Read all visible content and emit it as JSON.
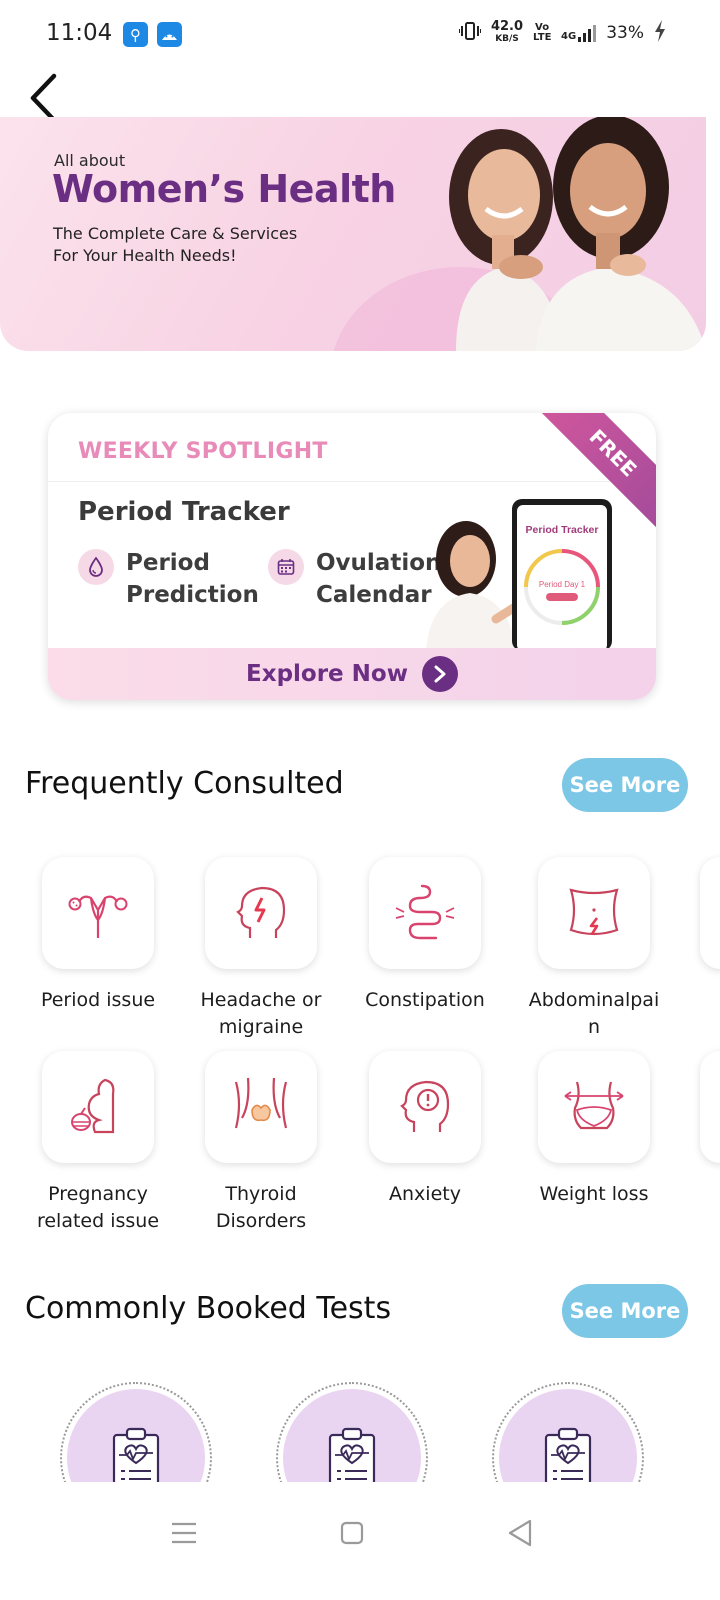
{
  "status_bar": {
    "time": "11:04",
    "speed_value": "42.0",
    "speed_unit": "KB/S",
    "volte": "Vo LTE",
    "network": "4G",
    "battery": "33%"
  },
  "header": {
    "back_icon": "chevron-left-icon"
  },
  "banner": {
    "pretitle": "All about",
    "title": "Women’s Health",
    "subtitle_line1": "The Complete Care & Services",
    "subtitle_line2": "For Your Health Needs!"
  },
  "spotlight": {
    "heading": "WEEKLY SPOTLIGHT",
    "ribbon": "FREE",
    "title": "Period Tracker",
    "features": [
      {
        "label_line1": "Period",
        "label_line2": "Prediction",
        "icon": "droplet-icon"
      },
      {
        "label_line1": "Ovulation",
        "label_line2": "Calendar",
        "icon": "calendar-icon"
      }
    ],
    "phone_title": "Period Tracker",
    "phone_day": "Period Day 1",
    "cta": "Explore Now",
    "colors": {
      "accent": "#6a2e83",
      "pink": "#e88bb8"
    }
  },
  "frequently_consulted": {
    "title": "Frequently Consulted",
    "see_more": "See More",
    "items": [
      {
        "label_line1": "Period issue",
        "label_line2": "",
        "icon": "uterus-icon"
      },
      {
        "label_line1": "Headache or",
        "label_line2": "migraine",
        "icon": "headache-icon"
      },
      {
        "label_line1": "Constipation",
        "label_line2": "",
        "icon": "intestine-icon"
      },
      {
        "label_line1": "Abdominalpai",
        "label_line2": "n",
        "icon": "abdomen-pain-icon"
      },
      {
        "label_line1": "Pregnancy",
        "label_line2": "related issue",
        "icon": "pregnancy-icon"
      },
      {
        "label_line1": "Thyroid",
        "label_line2": "Disorders",
        "icon": "thyroid-icon"
      },
      {
        "label_line1": "Anxiety",
        "label_line2": "",
        "icon": "anxiety-icon"
      },
      {
        "label_line1": "Weight loss",
        "label_line2": "",
        "icon": "weight-loss-icon"
      }
    ]
  },
  "commonly_booked_tests": {
    "title": "Commonly Booked Tests",
    "see_more": "See More",
    "items": [
      {
        "icon": "clipboard-heart-icon"
      },
      {
        "icon": "clipboard-heart-icon"
      },
      {
        "icon": "clipboard-heart-icon"
      }
    ]
  },
  "navbar": {
    "menu_icon": "menu-icon",
    "home_icon": "home-square-icon",
    "back_icon": "back-triangle-icon"
  }
}
